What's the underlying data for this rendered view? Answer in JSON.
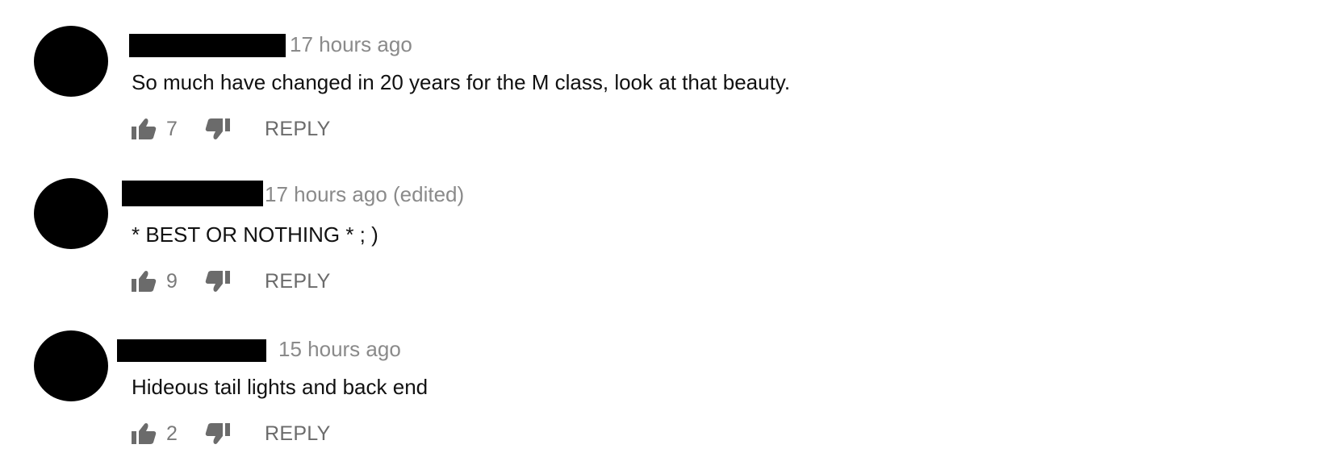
{
  "comments": [
    {
      "timestamp": "17 hours ago",
      "text": "So much have changed in 20 years for the M class, look at that beauty.",
      "likes": "7",
      "reply_label": "REPLY"
    },
    {
      "timestamp": "17 hours ago (edited)",
      "text": "* BEST OR NOTHING * ; )",
      "likes": "9",
      "reply_label": "REPLY"
    },
    {
      "timestamp": "15 hours ago",
      "text": "Hideous tail lights and back end",
      "likes": "2",
      "reply_label": "REPLY"
    }
  ],
  "colors": {
    "text": "#111111",
    "meta": "#8a8a8a",
    "icon": "#6b6b6b",
    "redaction": "#000000"
  },
  "icons": {
    "like": "thumbs-up-icon",
    "dislike": "thumbs-down-icon"
  }
}
